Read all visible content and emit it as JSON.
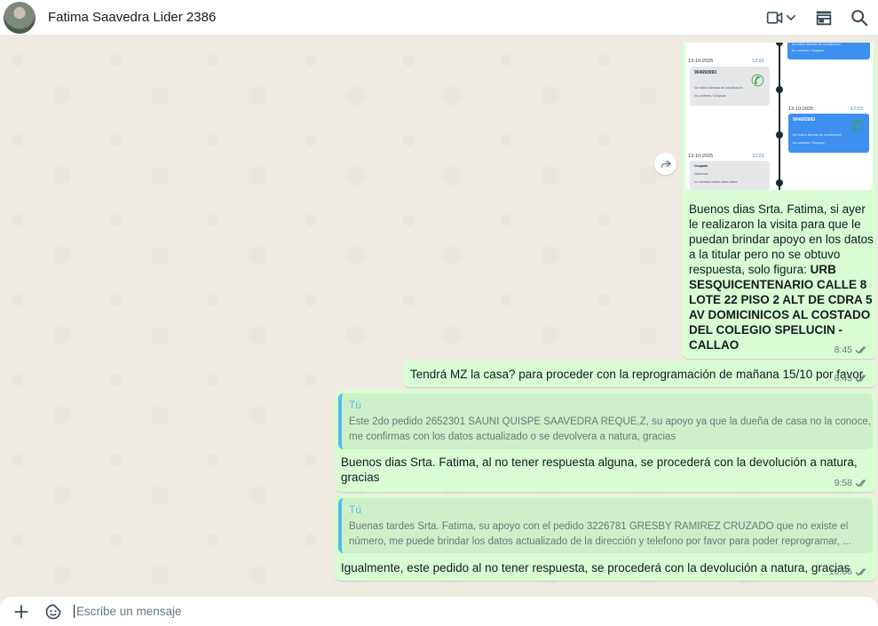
{
  "header": {
    "contact_name": "Fatima Saavedra Lider 2386",
    "icons": [
      "video-call-icon",
      "chevron-down-icon",
      "catalog-store-icon",
      "search-icon"
    ]
  },
  "image_message": {
    "thumbnail": {
      "entries": [
        {
          "date": "13-10-2025",
          "time": "12:22",
          "number": "904693993",
          "line1": "No realizó llamada de coordinación",
          "line2": "No contesta / Ocupado"
        },
        {
          "date": "13-10-2025",
          "time": "12:23",
          "number": "904693993",
          "line1": "No realizó llamada de coordinación",
          "line2": "No contesta / Ocupado"
        },
        {
          "date": "13-10-2025",
          "time": "12:23",
          "number": "Ocupado",
          "line1": "Deficiente",
          "line2": "no contesta celular faltan datos"
        }
      ],
      "top_card": {
        "line1": "No realizó llamada de coordinación",
        "line2": "No contesta / Ocupado"
      }
    },
    "caption_regular": "Buenos dias Srta. Fatima, si ayer le realizaron la visita para que le puedan brindar apoyo en los datos a la titular pero no se obtuvo respuesta, solo figura: ",
    "caption_bold": "URB SESQUICENTENARIO CALLE 8 LOTE 22 PISO 2 ALT DE CDRA 5 AV DOMICINICOS AL COSTADO DEL COLEGIO SPELUCIN - CALLAO",
    "time": "8:45"
  },
  "messages": [
    {
      "text": "Tendrá MZ la casa? para proceder con la reprogramación de mañana 15/10 por favor",
      "time": "8:45"
    },
    {
      "quote_author": "Tú",
      "quote_line1": "Este 2do pedido 2652301 SAUNI QUISPE SAAVEDRA REQUE,Z, su apoyo ya que la dueña de casa no la conoce,",
      "quote_line2": "me confirmas con los datos actualizado o se devolvera  a natura, gracias",
      "text": "Buenos dias Srta. Fatima, al no tener respuesta alguna, se procederá con la devolución a natura, gracias",
      "time": "9:58"
    },
    {
      "quote_author": "Tú",
      "quote_line1": "Buenas tardes Srta. Fatima, su apoyo con el pedido 3226781 GRESBY RAMIREZ CRUZADO que no existe el",
      "quote_line2": "número, me puede brindar los datos actualizado de la dirección y telefono por favor para poder reprogramar, ...",
      "text": "Igualmente, este pedido al no tener respuesta, se procederá con la devolución a natura, gracias",
      "time": "10:06"
    }
  ],
  "footer": {
    "input_placeholder": "Escribe un mensaje"
  },
  "colors": {
    "bubble_out": "#d9fdd3",
    "chat_bg": "#efeae2",
    "quote_author": "#53bdeb",
    "read_ticks": "#667781"
  }
}
